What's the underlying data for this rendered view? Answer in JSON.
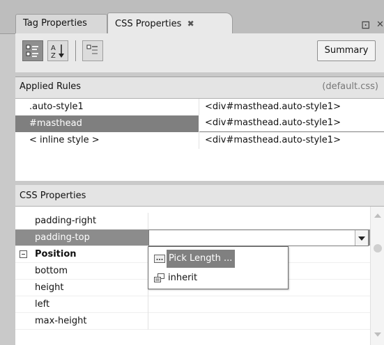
{
  "tabs": [
    {
      "label": "Tag Properties"
    },
    {
      "label": "CSS Properties",
      "close": "✖"
    }
  ],
  "window": {
    "pin": "⊡",
    "close": "✕"
  },
  "toolbar": {
    "summary_label": "Summary"
  },
  "applied_rules": {
    "title": "Applied Rules",
    "file": "(default.css)",
    "rows": [
      {
        "selector": ".auto-style1",
        "element": "<div#masthead.auto-style1>"
      },
      {
        "selector": "#masthead",
        "element": "<div#masthead.auto-style1>"
      },
      {
        "selector": "< inline style >",
        "element": "<div#masthead.auto-style1>"
      }
    ]
  },
  "css_properties": {
    "title": "CSS Properties",
    "rows": [
      {
        "name": "padding-right"
      },
      {
        "name": "padding-top"
      },
      {
        "name": "Position",
        "expander": "−"
      },
      {
        "name": "bottom"
      },
      {
        "name": "height"
      },
      {
        "name": "left"
      },
      {
        "name": "max-height"
      }
    ]
  },
  "dropdown": {
    "items": [
      {
        "label": "Pick Length ..."
      },
      {
        "label": "inherit"
      }
    ]
  },
  "colors": {
    "selected_row": "#808080",
    "header_bg": "#e4e4e4"
  }
}
